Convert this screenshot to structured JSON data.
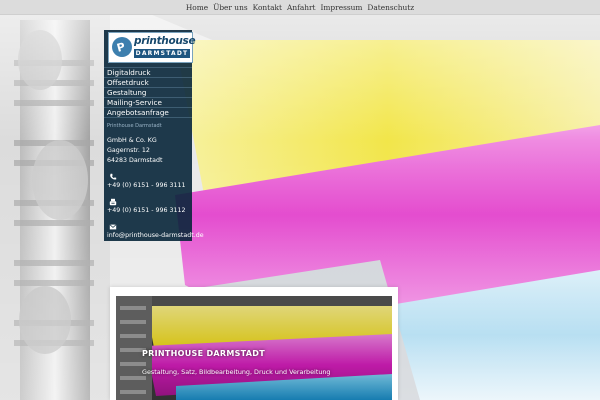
{
  "nav": {
    "items": [
      "Home",
      "Über uns",
      "Kontakt",
      "Anfahrt",
      "Impressum",
      "Datenschutz"
    ]
  },
  "logo": {
    "word": "printhouse",
    "city": "DARMSTADT"
  },
  "sidebar": {
    "menu": [
      "Digitaldruck",
      "Offsetdruck",
      "Gestaltung",
      "Mailing-Service",
      "Angebotsanfrage"
    ],
    "company_small": "Printhouse Darmstadt",
    "address": [
      "GmbH & Co. KG",
      "Gagernstr. 12",
      "64283 Darmstadt"
    ],
    "phone": "+49 (0) 6151 - 996 3111",
    "fax": "+49 (0) 6151 - 996 3112",
    "email": "info@printhouse-darmstadt.de"
  },
  "card": {
    "title": "PRINTHOUSE DARMSTADT",
    "subtitle": "Gestaltung, Satz, Bildbearbeitung, Druck und Verarbeitung"
  },
  "icons": {
    "phone": "phone-icon",
    "fax": "fax-icon",
    "email": "envelope-icon"
  },
  "colors": {
    "sidebar_bg": "#08263a",
    "cyan": "#4fb7e6",
    "magenta": "#e23fcb",
    "yellow": "#f4e93c"
  }
}
